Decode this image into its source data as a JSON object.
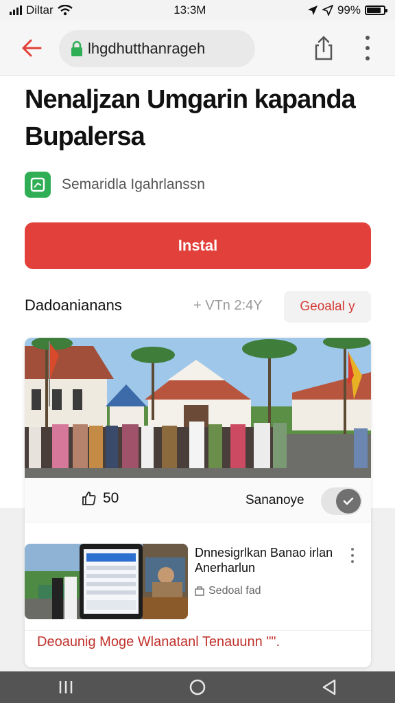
{
  "status_bar": {
    "carrier": "Diltar",
    "time": "13:3M",
    "battery_percent": "99%",
    "battery_level": 0.85
  },
  "browser": {
    "url": "lhgdhutthanrageh",
    "icons": [
      "back-arrow-icon",
      "lock-icon",
      "share-icon",
      "more-vertical-icon"
    ]
  },
  "article": {
    "headline": "Nenaljzan Umgarin kapanda Bupalersa",
    "app_name": "Semaridla Igahrlanssn",
    "install_label": "Instal",
    "section_title": "Dadoanianans",
    "section_meta": "+ VTn 2:4Y",
    "section_button": "Geoalal y"
  },
  "card": {
    "like_count": "50",
    "save_label": "Sananoye",
    "save_toggle_on": true,
    "news_title": "Dnnesigrlkan Banao irlan Anerharlun",
    "news_source": "Sedoal fad",
    "news_link": "Deoaunig Moge Wlanatanl Tenauunn \"\"."
  },
  "colors": {
    "accent_red": "#e2403a",
    "app_icon_green": "#2fae55"
  }
}
